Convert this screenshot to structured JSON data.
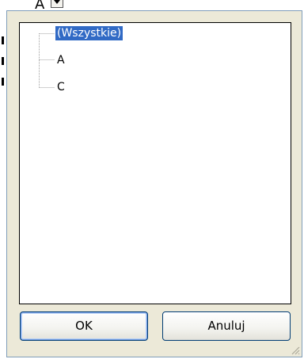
{
  "background": {
    "column_letter": "A"
  },
  "filter_popup": {
    "tree": {
      "items": [
        {
          "label": "(Wszystkie)",
          "selected": true
        },
        {
          "label": "A",
          "selected": false
        },
        {
          "label": "C",
          "selected": false
        }
      ]
    },
    "buttons": {
      "ok_label": "OK",
      "cancel_label": "Anuluj"
    }
  },
  "colors": {
    "selection": "#316ac5",
    "dialog_bg": "#ece9d8",
    "button_border": "#003c74"
  }
}
